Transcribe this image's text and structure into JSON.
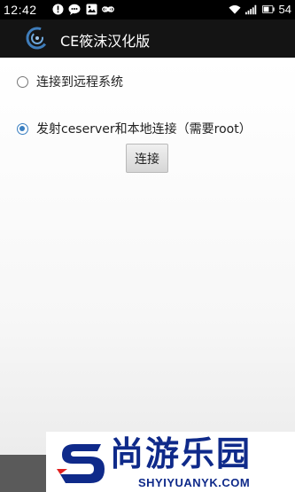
{
  "status_bar": {
    "time": "12:42",
    "battery": "54",
    "left_icons": [
      "alert-icon",
      "chat-icon",
      "image-icon",
      "infinity-icon"
    ],
    "right_icons": [
      "wifi-icon",
      "signal-icon",
      "battery-icon"
    ]
  },
  "action_bar": {
    "title": "CE筱沫汉化版",
    "icon": "ce-logo-icon"
  },
  "options": [
    {
      "label": "连接到远程系统",
      "checked": false
    },
    {
      "label": "发射ceserver和本地连接（需要root）",
      "checked": true
    }
  ],
  "connect_button": {
    "label": "连接"
  },
  "watermark": {
    "text": "尚游乐园",
    "url": "SHYIYUANYK.COM"
  },
  "colors": {
    "accent": "#3a7fc1",
    "action_bar_bg": "#141414",
    "watermark_blue": "#0f2a8a"
  }
}
